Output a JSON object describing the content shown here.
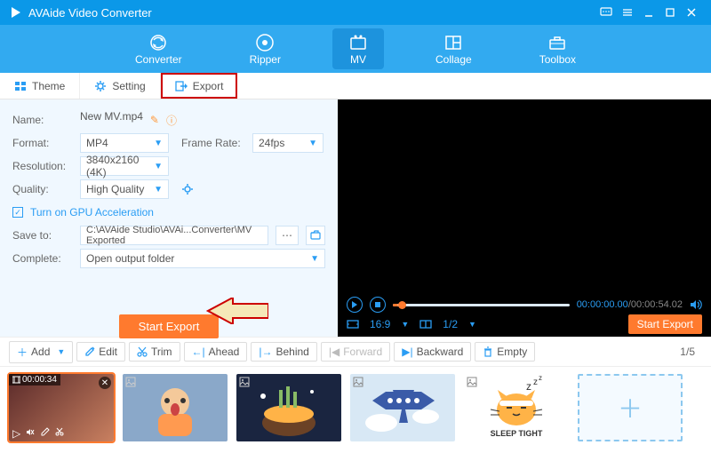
{
  "titlebar": {
    "title": "AVAide Video Converter"
  },
  "topnav": {
    "items": [
      "Converter",
      "Ripper",
      "MV",
      "Collage",
      "Toolbox"
    ],
    "active": 2
  },
  "tabs": {
    "items": [
      "Theme",
      "Setting",
      "Export"
    ],
    "selected": 2
  },
  "panel": {
    "name_label": "Name:",
    "name_value": "New MV.mp4",
    "format_label": "Format:",
    "format_value": "MP4",
    "framerate_label": "Frame Rate:",
    "framerate_value": "24fps",
    "resolution_label": "Resolution:",
    "resolution_value": "3840x2160 (4K)",
    "quality_label": "Quality:",
    "quality_value": "High Quality",
    "gpu_label": "Turn on GPU Acceleration",
    "saveto_label": "Save to:",
    "saveto_value": "C:\\AVAide Studio\\AVAi...Converter\\MV Exported",
    "complete_label": "Complete:",
    "complete_value": "Open output folder",
    "start_button": "Start Export"
  },
  "preview": {
    "time_current": "00:00:00.00",
    "time_total": "00:00:54.02",
    "aspect": "16:9",
    "page_current": "1",
    "page_total": "2",
    "start_button": "Start Export"
  },
  "editbar": {
    "add": "Add",
    "edit": "Edit",
    "trim": "Trim",
    "ahead": "Ahead",
    "behind": "Behind",
    "forward": "Forward",
    "backward": "Backward",
    "empty": "Empty",
    "counter_current": "1",
    "counter_total": "5"
  },
  "thumbs": {
    "duration": "00:00:34"
  }
}
